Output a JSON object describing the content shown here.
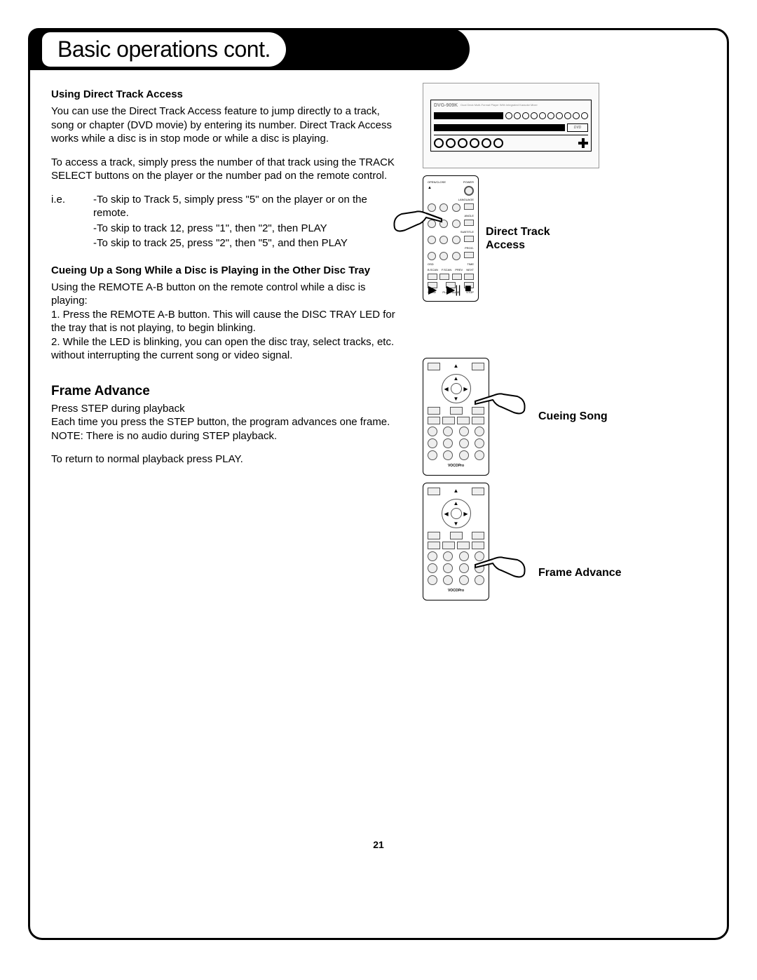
{
  "tab_title": "Basic operations cont.",
  "page_number": "21",
  "left": {
    "h1": "Using Direct Track Access",
    "p1": "You can use the Direct Track Access feature to jump directly to a track, song or chapter (DVD movie) by entering its number.  Direct Track Access works while a disc is in stop mode or while a disc is playing.",
    "p2": "To access a track, simply press the number of that track using the TRACK SELECT buttons on the player or the number pad on the remote control.",
    "ex_label": "i.e.",
    "ex1": "-To skip to Track 5, simply press \"5\" on the player  or on the remote.",
    "ex2": "-To skip to track 12, press \"1\", then \"2\", then  PLAY",
    "ex3": "-To skip to track 25, press \"2\", then \"5\", and then  PLAY",
    "h2": "Cueing Up a Song While a Disc is Playing in the Other Disc Tray",
    "p3": "Using the REMOTE A-B button on the remote control while a disc is playing:",
    "p4": "1.  Press the REMOTE A-B button.  This will cause the DISC TRAY LED for the tray that is not playing, to begin blinking.",
    "p5": "2.  While the LED is blinking, you can open the disc tray, select tracks, etc. without interrupting the current song or video signal.",
    "h3": "Frame Advance",
    "p6": "Press STEP during playback",
    "p7": "Each time you press the STEP button, the program advances one frame.",
    "p8": "NOTE: There is no audio during STEP playback.",
    "p9": "To return to normal playback press PLAY."
  },
  "right": {
    "player_model": "DVG-909K",
    "player_desc": "Dual Deck Multi-Format Player With Integrated Karaoke Mixer",
    "caption1a": "Direct Track",
    "caption1b": "Access",
    "caption2": "Cueing Song",
    "caption3": "Frame Advance",
    "remote_labels": {
      "open_close": "OPEN/CLOSE",
      "power": "POWER",
      "language": "LANGUAGE",
      "angle": "ANGLE",
      "subtitle": "SUBTITLE",
      "prog": "PROG.",
      "osd": "OSD",
      "time": "TIME",
      "bscan": "B.SCAN",
      "fscan": "F.SCAN",
      "prev": "PREV",
      "next": "NEXT",
      "slow": "SLOW",
      "playpause": "PLAY/PAUSE",
      "stop": "STOP",
      "brand": "VOCOPro"
    }
  }
}
